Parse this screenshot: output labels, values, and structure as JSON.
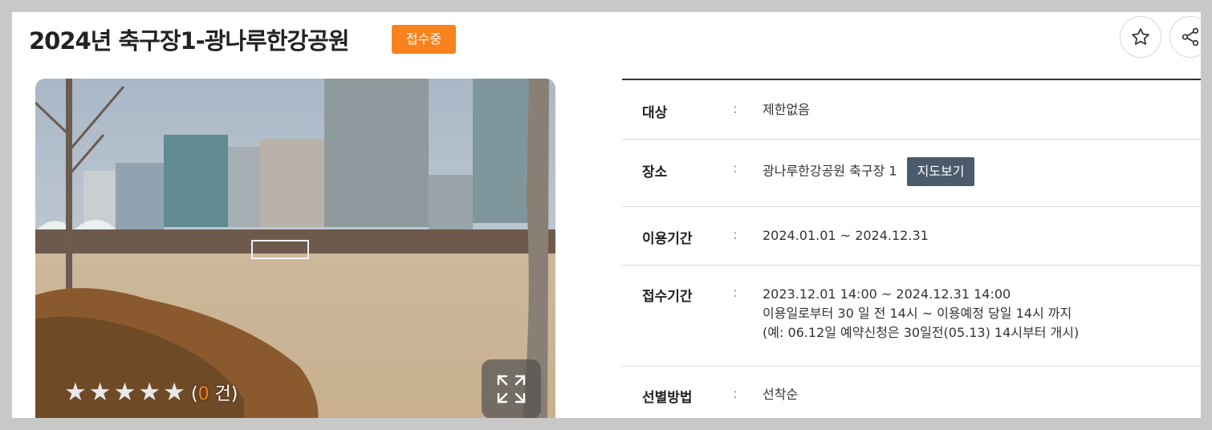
{
  "header": {
    "title": "2024년 축구장1-광나루한강공원",
    "status_badge": "접수중",
    "favorite_icon": "star-outline-icon",
    "share_icon": "share-icon"
  },
  "photo": {
    "rating_stars": 5,
    "rating_open": "(",
    "rating_count": "0",
    "rating_unit": " 건)",
    "expand_icon": "expand-icon"
  },
  "info": {
    "rows": [
      {
        "label": "대상",
        "colon": ":",
        "lines": [
          "제한없음"
        ]
      },
      {
        "label": "장소",
        "colon": ":",
        "lines": [
          "광나루한강공원 축구장 1"
        ],
        "button": "지도보기"
      },
      {
        "label": "이용기간",
        "colon": ":",
        "lines": [
          "2024.01.01 ~ 2024.12.31"
        ]
      },
      {
        "label": "접수기간",
        "colon": ":",
        "lines": [
          "2023.12.01 14:00 ~ 2024.12.31 14:00",
          "이용일로부터 30 일 전 14시 ~ 이용예정 당일 14시 까지",
          "(예: 06.12일 예약신청은 30일전(05.13) 14시부터 개시)"
        ]
      },
      {
        "label": "선별방법",
        "colon": ":",
        "lines": [
          "선착순"
        ]
      }
    ]
  },
  "colors": {
    "badge": "#f7821e",
    "map_button": "#4a5b6d",
    "rating_count": "#f7821e"
  }
}
